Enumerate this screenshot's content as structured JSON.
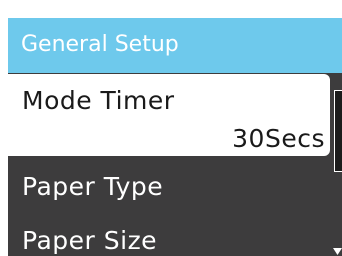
{
  "screen": {
    "title": "General Setup",
    "background_color": "#3d3c3d",
    "title_bar_color": "#6ec9ec"
  },
  "menu": {
    "items": [
      {
        "label": "Mode Timer",
        "value": "30Secs",
        "selected": true
      },
      {
        "label": "Paper Type"
      },
      {
        "label": "Paper Size"
      }
    ]
  },
  "scrollbar": {
    "more_below": true,
    "arrow_icon": "triangle-down-icon"
  }
}
